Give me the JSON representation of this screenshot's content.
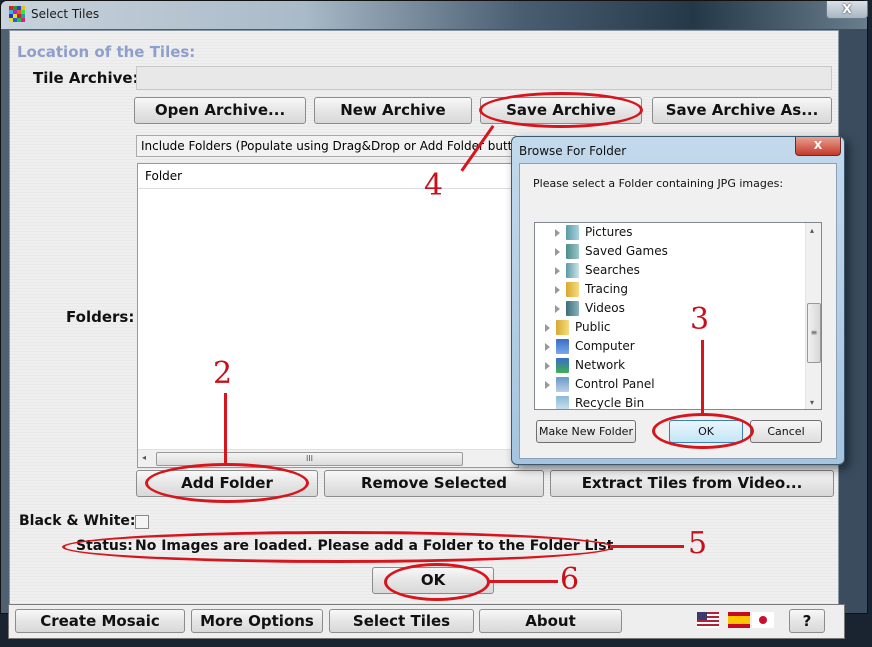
{
  "window": {
    "title": "Select Tiles",
    "close_label": "X"
  },
  "main": {
    "section_heading": "Location of the Tiles:",
    "tile_archive_label": "Tile Archive:",
    "tile_archive_value": "",
    "buttons": {
      "open_archive": "Open Archive...",
      "new_archive": "New Archive",
      "save_archive": "Save Archive",
      "save_archive_as": "Save Archive As...",
      "add_folder": "Add Folder",
      "remove_selected": "Remove Selected",
      "extract_tiles": "Extract Tiles from Video...",
      "ok": "OK"
    },
    "include_folders_text": "Include Folders (Populate using Drag&Drop or Add Folder button)",
    "folders_label": "Folders:",
    "list_header": "Folder",
    "scroll_grip": "III",
    "black_white_label": "Black & White:",
    "black_white_checked": false,
    "status_label": "Status:",
    "status_text": "No Images are loaded. Please add a Folder to the Folder List"
  },
  "bottom_bar": {
    "tabs": [
      "Create Mosaic",
      "More Options",
      "Select Tiles",
      "About"
    ],
    "help_label": "?",
    "flags": [
      "us-flag",
      "spain-flag",
      "japan-flag"
    ]
  },
  "dialog": {
    "title": "Browse For Folder",
    "close_label": "X",
    "prompt": "Please select a Folder containing JPG images:",
    "tree_items": [
      {
        "label": "Pictures",
        "icon": "pictures-folder-icon",
        "level": 2
      },
      {
        "label": "Saved Games",
        "icon": "saved-games-folder-icon",
        "level": 2
      },
      {
        "label": "Searches",
        "icon": "searches-folder-icon",
        "level": 2
      },
      {
        "label": "Tracing",
        "icon": "folder-icon",
        "level": 2
      },
      {
        "label": "Videos",
        "icon": "videos-folder-icon",
        "level": 2
      },
      {
        "label": "Public",
        "icon": "folder-icon",
        "level": 1
      },
      {
        "label": "Computer",
        "icon": "computer-icon",
        "level": 1
      },
      {
        "label": "Network",
        "icon": "network-icon",
        "level": 1
      },
      {
        "label": "Control Panel",
        "icon": "control-panel-icon",
        "level": 1
      },
      {
        "label": "Recycle Bin",
        "icon": "recycle-bin-icon",
        "level": 1
      }
    ],
    "buttons": {
      "make_new_folder": "Make New Folder",
      "ok": "OK",
      "cancel": "Cancel"
    }
  },
  "annotations": {
    "step_2": "2",
    "step_3": "3",
    "step_4": "4",
    "step_5": "5",
    "step_6": "6",
    "color": "#d8141c"
  }
}
